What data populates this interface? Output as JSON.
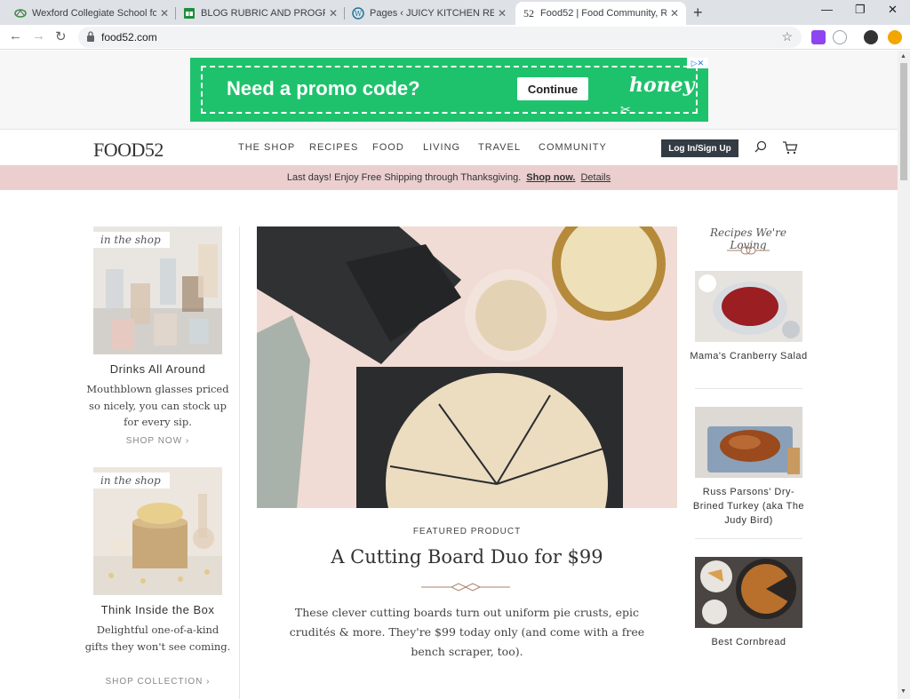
{
  "browser": {
    "tabs": [
      {
        "title": "Wexford Collegiate School for the",
        "favicon": "school-icon"
      },
      {
        "title": "BLOG RUBRIC AND PROGRESS M",
        "favicon": "sheets-icon"
      },
      {
        "title": "Pages ‹ JUICY KITCHEN RECIPES",
        "favicon": "wordpress-icon"
      },
      {
        "title": "Food52 | Food Community, Recip",
        "favicon": "food52-icon",
        "favicon_text": "52"
      }
    ],
    "new_tab": "+",
    "window": {
      "minimize": "—",
      "restore": "❐",
      "close": "✕"
    },
    "url": "food52.com"
  },
  "ad": {
    "headline": "Need a promo code?",
    "cta": "Continue",
    "brand": "honey",
    "adchoice": "▷✕"
  },
  "site": {
    "logo": "FOOD52",
    "nav": [
      "THE SHOP",
      "RECIPES",
      "FOOD",
      "LIVING",
      "TRAVEL",
      "COMMUNITY"
    ],
    "login": "Log In/Sign Up"
  },
  "promo": {
    "text": "Last days! Enjoy Free Shipping through Thanksgiving.",
    "link1": "Shop now.",
    "link2": "Details"
  },
  "shop_cards": [
    {
      "tag": "in the shop",
      "title": "Drinks All Around",
      "desc": "Mouthblown glasses priced so nicely, you can stock up for every sip.",
      "link": "SHOP NOW"
    },
    {
      "tag": "in the shop",
      "title": "Think Inside the Box",
      "desc": "Delightful one-of-a-kind gifts they won't see coming.",
      "link": "SHOP COLLECTION"
    }
  ],
  "feature": {
    "kicker": "FEATURED PRODUCT",
    "headline": "A Cutting Board Duo for $99",
    "deck": "These clever cutting boards turn out uniform pie crusts, epic crudités & more. They're $99 today only (and come with a free bench scraper, too)."
  },
  "recipes": {
    "heading": "Recipes We're Loving",
    "items": [
      {
        "title": "Mama's Cranberry Salad"
      },
      {
        "title": "Russ Parsons' Dry-Brined Turkey (aka The Judy Bird)"
      },
      {
        "title": "Best Cornbread"
      }
    ]
  },
  "colors": {
    "ad_green": "#1fc26c",
    "promo_pink": "#ebcfcf",
    "login_dark": "#333c45"
  }
}
